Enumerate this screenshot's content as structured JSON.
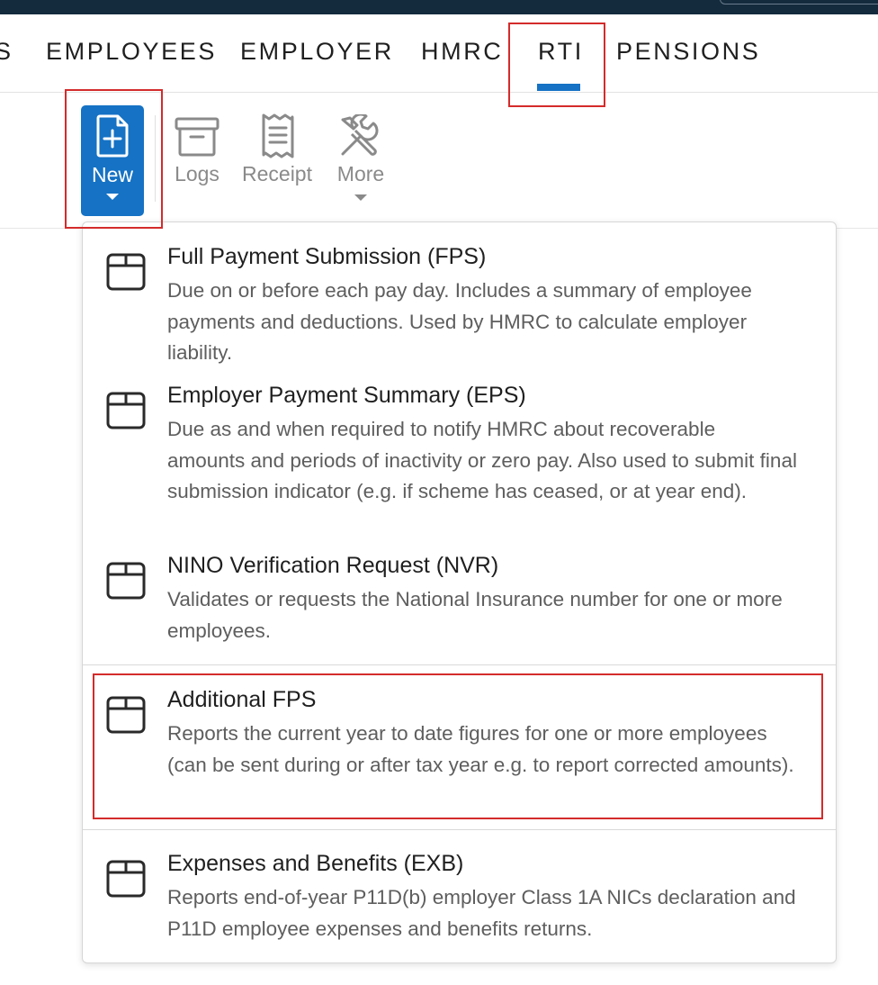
{
  "nav": {
    "items": [
      {
        "label": "S"
      },
      {
        "label": "EMPLOYEES"
      },
      {
        "label": "EMPLOYER"
      },
      {
        "label": "HMRC"
      },
      {
        "label": "RTI"
      },
      {
        "label": "PENSIONS"
      }
    ],
    "active": "RTI"
  },
  "toolbar": {
    "new_label": "New",
    "logs_label": "Logs",
    "receipt_label": "Receipt",
    "more_label": "More"
  },
  "menu": {
    "items": [
      {
        "title": "Full Payment Submission (FPS)",
        "desc": "Due on or before each pay day. Includes a summary of employee payments and deductions. Used by HMRC to calculate employer liability."
      },
      {
        "title": "Employer Payment Summary (EPS)",
        "desc": "Due as and when required to notify HMRC about recoverable amounts and periods of inactivity or zero pay. Also used to submit final submission indicator (e.g. if scheme has ceased, or at year end)."
      },
      {
        "title": "NINO Verification Request (NVR)",
        "desc": "Validates or requests the National Insurance number for one or more employees."
      },
      {
        "title": "Additional FPS",
        "desc": "Reports the current year to date figures for one or more employees (can be sent during or after tax year e.g. to report corrected amounts)."
      },
      {
        "title": "Expenses and Benefits (EXB)",
        "desc": "Reports end-of-year P11D(b) employer Class 1A NICs declaration and P11D employee expenses and benefits returns."
      }
    ]
  },
  "colors": {
    "accent": "#1572c4",
    "highlight": "#d42b2b",
    "topbar": "#142a3d"
  }
}
